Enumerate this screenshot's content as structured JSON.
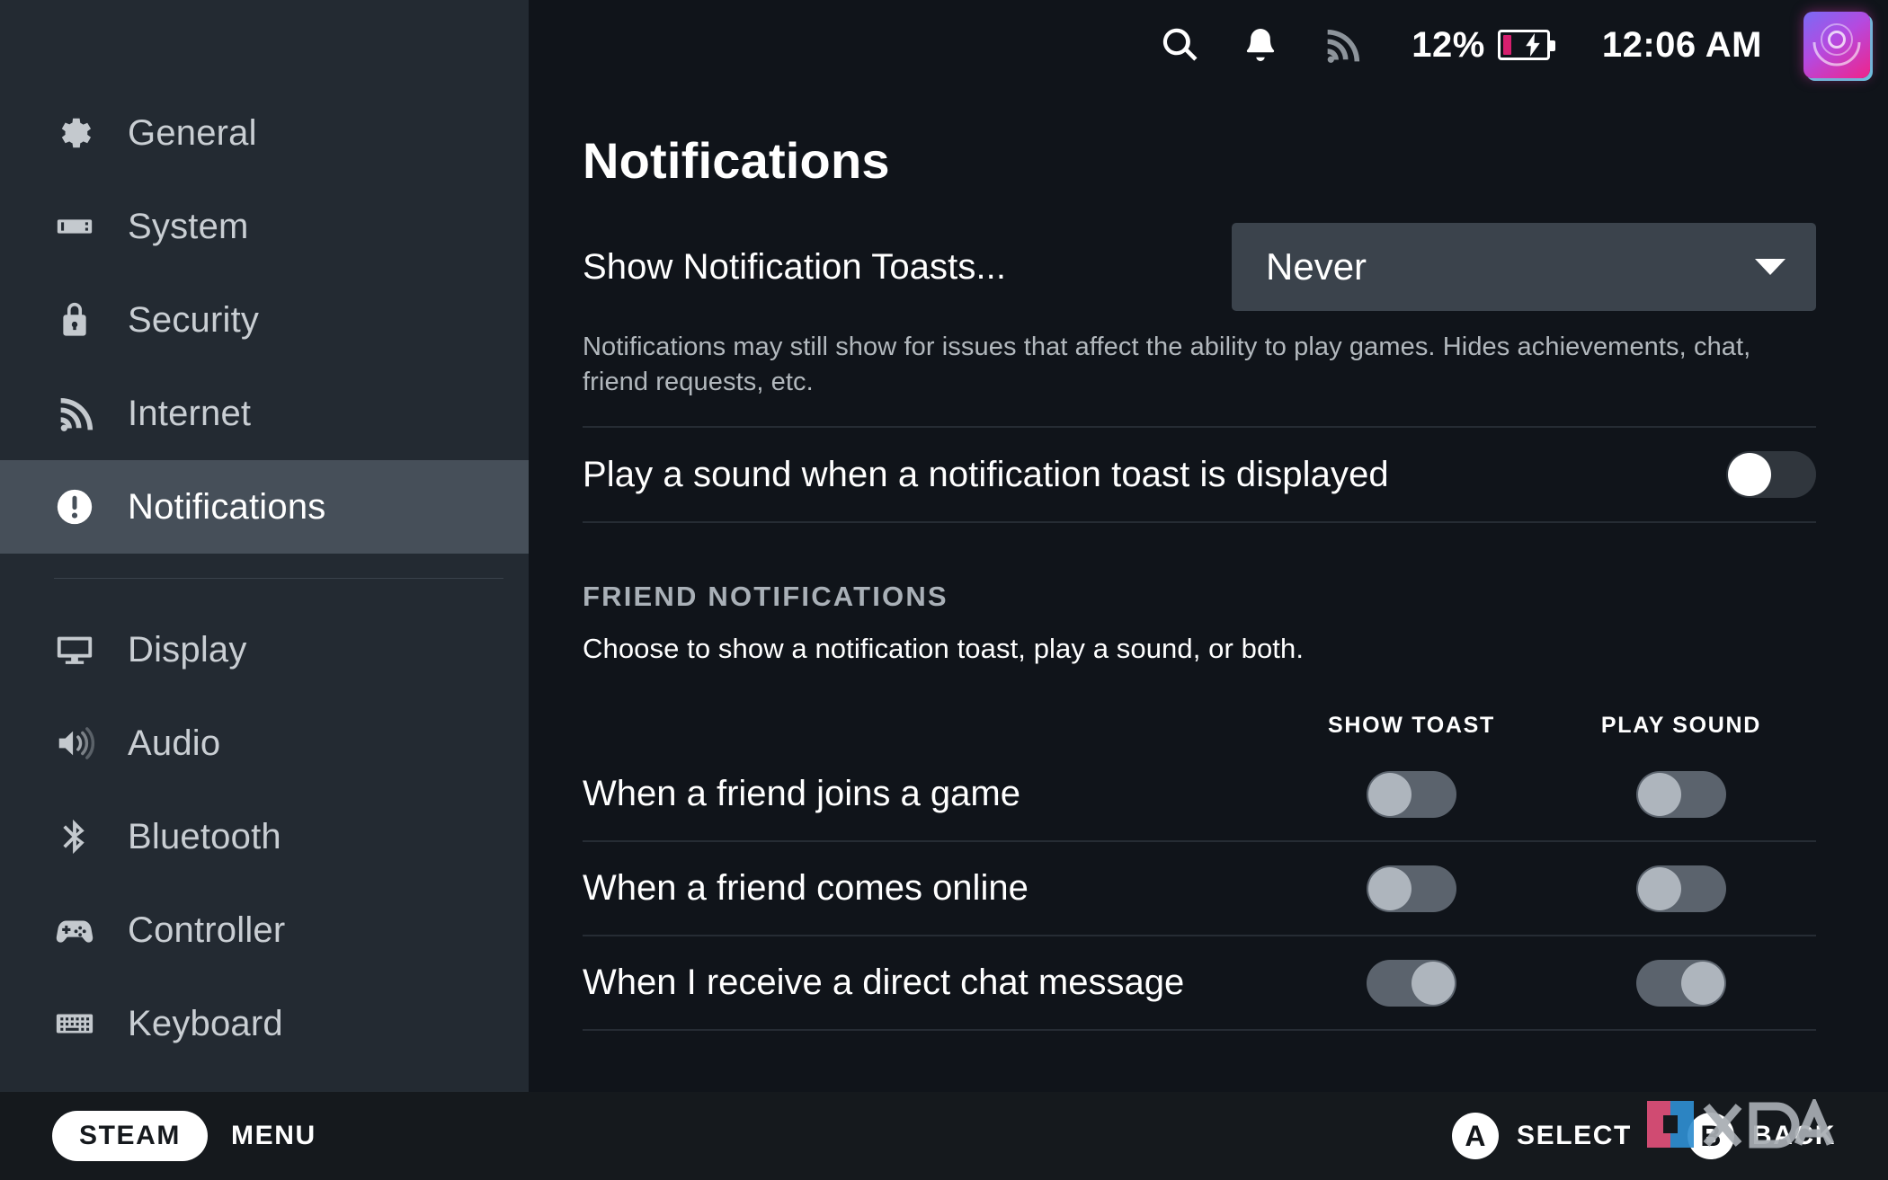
{
  "topbar": {
    "search_icon": "search-icon",
    "bell_icon": "notifications-bell-icon",
    "wifi_icon": "wifi-signal-icon",
    "battery_percent": "12%",
    "battery_state": "charging",
    "battery_color": "#d61f6e",
    "clock": "12:06 AM",
    "avatar": "user-avatar"
  },
  "sidebar": {
    "items": [
      {
        "label": "General",
        "icon": "gear-icon",
        "selected": false
      },
      {
        "label": "System",
        "icon": "handheld-icon",
        "selected": false
      },
      {
        "label": "Security",
        "icon": "lock-icon",
        "selected": false
      },
      {
        "label": "Internet",
        "icon": "wifi-icon",
        "selected": false
      },
      {
        "label": "Notifications",
        "icon": "alert-circle-icon",
        "selected": true
      }
    ],
    "items_lower": [
      {
        "label": "Display",
        "icon": "monitor-icon",
        "selected": false
      },
      {
        "label": "Audio",
        "icon": "speaker-icon",
        "selected": false
      },
      {
        "label": "Bluetooth",
        "icon": "bluetooth-icon",
        "selected": false
      },
      {
        "label": "Controller",
        "icon": "gamepad-icon",
        "selected": false
      },
      {
        "label": "Keyboard",
        "icon": "keyboard-icon",
        "selected": false
      }
    ],
    "selected_color": "#464f59",
    "background": "#232a32"
  },
  "main": {
    "title": "Notifications",
    "toast_setting": {
      "label": "Show Notification Toasts...",
      "value": "Never",
      "help": "Notifications may still show for issues that affect the ability to play games. Hides achievements, chat, friend requests, etc."
    },
    "sound_setting": {
      "label": "Play a sound when a notification toast is displayed",
      "enabled": false
    },
    "friend_section": {
      "title": "FRIEND NOTIFICATIONS",
      "description": "Choose to show a notification toast, play a sound, or both.",
      "columns": [
        "SHOW TOAST",
        "PLAY SOUND"
      ],
      "rows": [
        {
          "label": "When a friend joins a game",
          "show_toast": false,
          "play_sound": false
        },
        {
          "label": "When a friend comes online",
          "show_toast": false,
          "play_sound": false
        },
        {
          "label": "When I receive a direct chat message",
          "show_toast": true,
          "play_sound": true
        }
      ]
    }
  },
  "footer": {
    "steam_label": "STEAM",
    "menu_label": "MENU",
    "a_button": "A",
    "a_label": "SELECT",
    "b_button": "B",
    "b_label": "BACK",
    "watermark": "XDA"
  }
}
